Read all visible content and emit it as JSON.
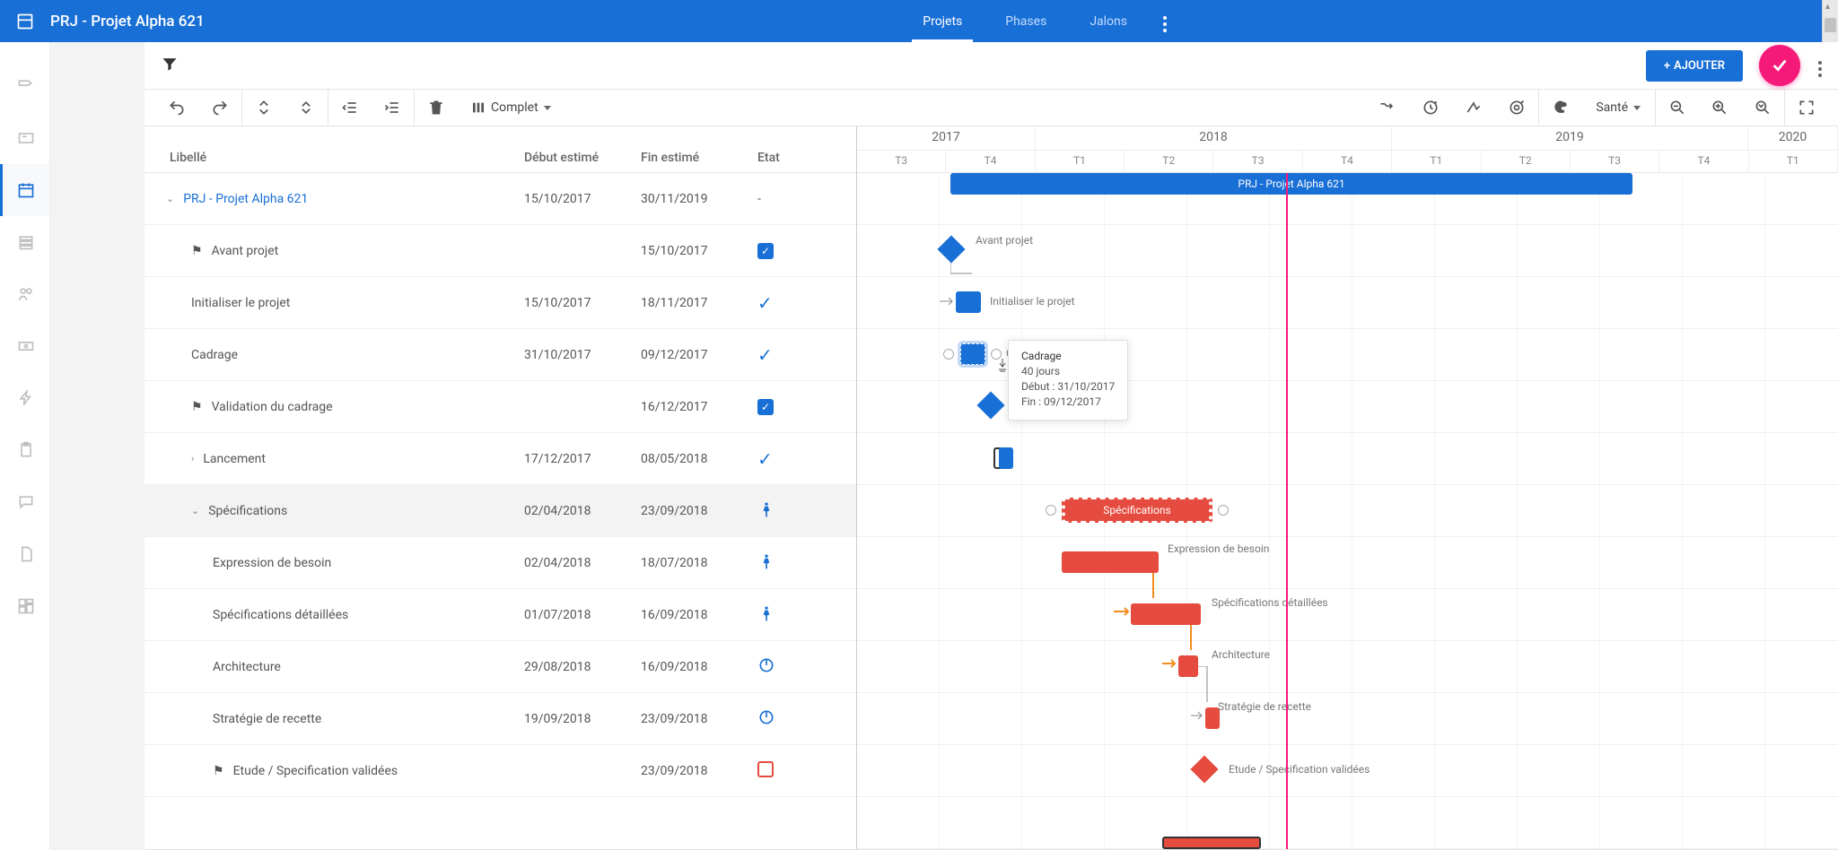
{
  "appTitle": "PRJ - Projet Alpha 621",
  "nav": {
    "tabs": [
      {
        "label": "Projets"
      },
      {
        "label": "Phases"
      },
      {
        "label": "Jalons"
      }
    ]
  },
  "actionbar": {
    "addLabel": "AJOUTER"
  },
  "toolbar": {
    "viewMode": "Complet",
    "healthLabel": "Santé"
  },
  "grid": {
    "columns": {
      "lib": "Libellé",
      "start": "Début estimé",
      "end": "Fin estimé",
      "state": "Etat"
    },
    "rows": [
      {
        "lib": "PRJ - Projet Alpha 621",
        "start": "15/10/2017",
        "end": "30/11/2019",
        "state": "-",
        "link": true,
        "indent": 0,
        "expand": "down"
      },
      {
        "lib": "Avant projet",
        "start": "",
        "end": "15/10/2017",
        "state": "cbox",
        "flag": true,
        "indent": 1
      },
      {
        "lib": "Initialiser le projet",
        "start": "15/10/2017",
        "end": "18/11/2017",
        "state": "check",
        "indent": 1
      },
      {
        "lib": "Cadrage",
        "start": "31/10/2017",
        "end": "09/12/2017",
        "state": "check",
        "indent": 1
      },
      {
        "lib": "Validation du cadrage",
        "start": "",
        "end": "16/12/2017",
        "state": "cbox",
        "flag": true,
        "indent": 1
      },
      {
        "lib": "Lancement",
        "start": "17/12/2017",
        "end": "08/05/2018",
        "state": "check",
        "indent": 1,
        "expand": "right"
      },
      {
        "lib": "Spécifications",
        "start": "02/04/2018",
        "end": "23/09/2018",
        "state": "worker",
        "indent": 1,
        "expand": "down",
        "selected": true
      },
      {
        "lib": "Expression de besoin",
        "start": "02/04/2018",
        "end": "18/07/2018",
        "state": "worker",
        "indent": 2
      },
      {
        "lib": "Spécifications détaillées",
        "start": "01/07/2018",
        "end": "16/09/2018",
        "state": "worker",
        "indent": 2
      },
      {
        "lib": "Architecture",
        "start": "29/08/2018",
        "end": "16/09/2018",
        "state": "power",
        "indent": 2
      },
      {
        "lib": "Stratégie de recette",
        "start": "19/09/2018",
        "end": "23/09/2018",
        "state": "power",
        "indent": 2
      },
      {
        "lib": "Etude / Specification validées",
        "start": "",
        "end": "23/09/2018",
        "state": "outline",
        "flag": true,
        "indent": 2
      }
    ]
  },
  "timeline": {
    "years": [
      "2017",
      "2018",
      "2019",
      "2020"
    ],
    "quarters": [
      "T3",
      "T4",
      "T1",
      "T2",
      "T3",
      "T4",
      "T1",
      "T2",
      "T3",
      "T4",
      "T1"
    ]
  },
  "tooltip": {
    "title": "Cadrage",
    "duration": "40 jours",
    "start": "Début : 31/10/2017",
    "end": "Fin : 09/12/2017"
  },
  "bars": {
    "proj": "PRJ - Projet Alpha 621",
    "avant": "Avant projet",
    "init": "Initialiser le projet",
    "cadrage": "Cadrage",
    "specs": "Spécifications",
    "expr": "Expression de besoin",
    "specd": "Spécifications détaillées",
    "arch": "Architecture",
    "strat": "Stratégie de recette",
    "etude": "Etude / Specification validées"
  }
}
